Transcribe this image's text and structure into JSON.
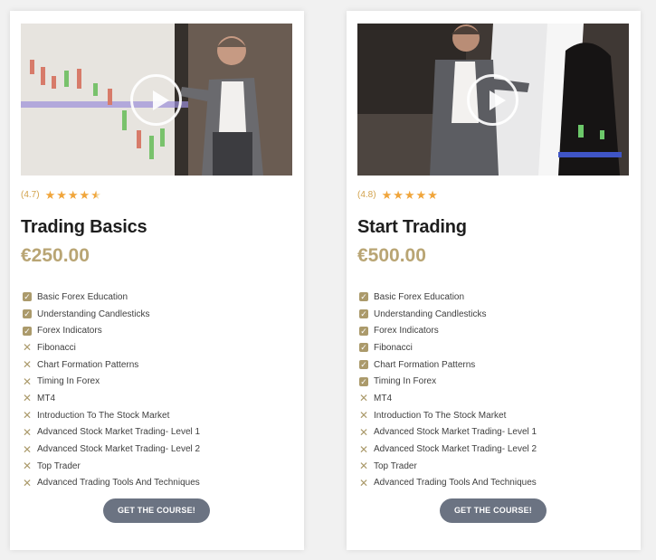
{
  "colors": {
    "accent": "#ab9a6b",
    "price": "#b9a574",
    "star": "#f0a53b",
    "button": "#6b7382"
  },
  "cards": [
    {
      "rating_text": "(4.7)",
      "rating": 4.7,
      "title": "Trading Basics",
      "price": "€250.00",
      "button_label": "GET THE COURSE!",
      "features": [
        {
          "label": "Basic Forex Education",
          "included": true,
          "icon": "check-icon"
        },
        {
          "label": "Understanding Candlesticks",
          "included": true,
          "icon": "check-icon"
        },
        {
          "label": "Forex Indicators",
          "included": true,
          "icon": "check-icon"
        },
        {
          "label": "Fibonacci",
          "included": false,
          "icon": "x-icon"
        },
        {
          "label": "Chart Formation Patterns",
          "included": false,
          "icon": "x-icon"
        },
        {
          "label": "Timing In Forex",
          "included": false,
          "icon": "x-icon"
        },
        {
          "label": "MT4",
          "included": false,
          "icon": "x-icon"
        },
        {
          "label": "Introduction To The Stock Market",
          "included": false,
          "icon": "x-icon"
        },
        {
          "label": "Advanced Stock Market Trading- Level 1",
          "included": false,
          "icon": "x-icon"
        },
        {
          "label": "Advanced Stock Market Trading- Level 2",
          "included": false,
          "icon": "x-icon"
        },
        {
          "label": "Top Trader",
          "included": false,
          "icon": "x-icon"
        },
        {
          "label": "Advanced Trading Tools And Techniques",
          "included": false,
          "icon": "x-icon"
        }
      ]
    },
    {
      "rating_text": "(4.8)",
      "rating": 4.8,
      "title": "Start Trading",
      "price": "€500.00",
      "button_label": "GET THE COURSE!",
      "features": [
        {
          "label": "Basic Forex Education",
          "included": true,
          "icon": "check-icon"
        },
        {
          "label": "Understanding Candlesticks",
          "included": true,
          "icon": "check-icon"
        },
        {
          "label": "Forex Indicators",
          "included": true,
          "icon": "check-icon"
        },
        {
          "label": "Fibonacci",
          "included": true,
          "icon": "check-icon"
        },
        {
          "label": "Chart Formation Patterns",
          "included": true,
          "icon": "check-icon"
        },
        {
          "label": "Timing In Forex",
          "included": true,
          "icon": "check-icon"
        },
        {
          "label": "MT4",
          "included": false,
          "icon": "x-icon"
        },
        {
          "label": "Introduction To The Stock Market",
          "included": false,
          "icon": "x-icon"
        },
        {
          "label": "Advanced Stock Market Trading- Level 1",
          "included": false,
          "icon": "x-icon"
        },
        {
          "label": "Advanced Stock Market Trading- Level 2",
          "included": false,
          "icon": "x-icon"
        },
        {
          "label": "Top Trader",
          "included": false,
          "icon": "x-icon"
        },
        {
          "label": "Advanced Trading Tools And Techniques",
          "included": false,
          "icon": "x-icon"
        }
      ]
    }
  ]
}
